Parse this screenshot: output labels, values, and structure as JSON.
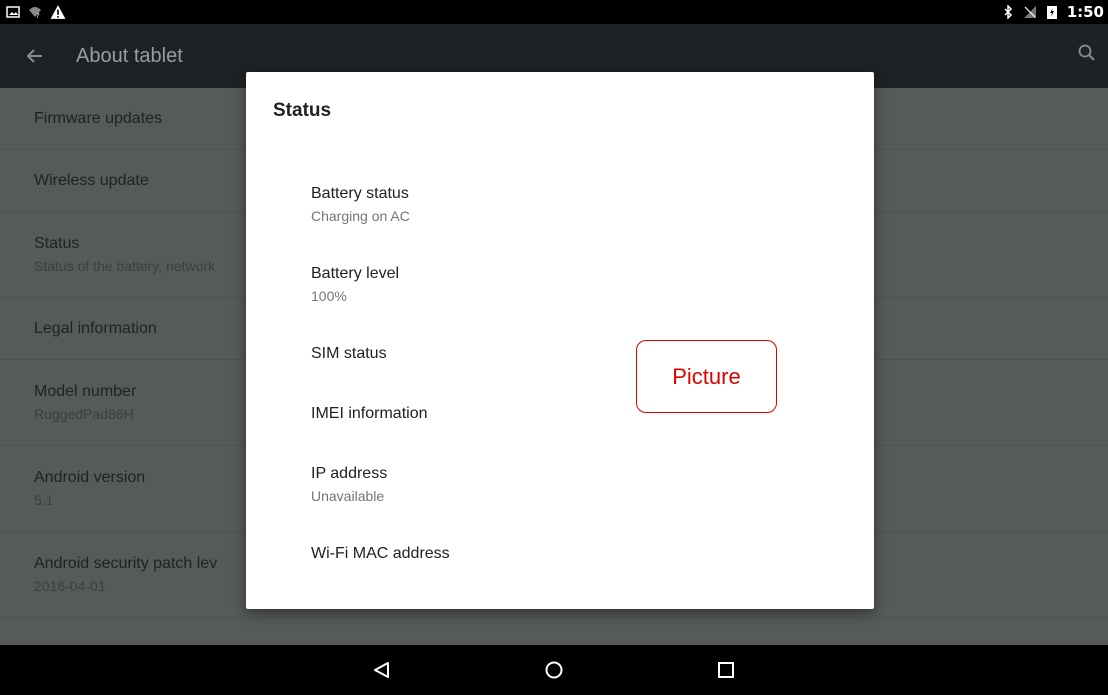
{
  "status_bar": {
    "time": "1:50",
    "left_icons": [
      "picture-notification-icon",
      "wifi-no-internet-icon",
      "warning-icon"
    ],
    "right_icons": [
      "bluetooth-icon",
      "no-signal-icon",
      "battery-charging-icon"
    ]
  },
  "app_bar": {
    "title": "About tablet",
    "back_icon": "arrow-left-icon",
    "search_icon": "search-icon"
  },
  "settings": {
    "items": [
      {
        "title": "Firmware updates",
        "subtitle": ""
      },
      {
        "title": "Wireless update",
        "subtitle": ""
      },
      {
        "title": "Status",
        "subtitle": "Status of the battery, network"
      },
      {
        "title": "Legal information",
        "subtitle": ""
      },
      {
        "title": "Model number",
        "subtitle": "RuggedPad86H"
      },
      {
        "title": "Android version",
        "subtitle": "5.1"
      },
      {
        "title": "Android security patch lev",
        "subtitle": "2016-04-01"
      }
    ]
  },
  "dialog": {
    "title": "Status",
    "items": [
      {
        "title": "Battery status",
        "subtitle": "Charging on AC"
      },
      {
        "title": "Battery level",
        "subtitle": "100%"
      },
      {
        "title": "SIM status",
        "subtitle": ""
      },
      {
        "title": "IMEI information",
        "subtitle": ""
      },
      {
        "title": "IP address",
        "subtitle": "Unavailable"
      },
      {
        "title": "Wi-Fi MAC address",
        "subtitle": ""
      }
    ],
    "annotation": "Picture"
  },
  "nav_bar": {
    "buttons": [
      "back-triangle-icon",
      "home-circle-icon",
      "recents-square-icon"
    ]
  },
  "colors": {
    "annotation": "#e00000",
    "app_bar": "#1f2224",
    "dim_background": "#575a5b"
  }
}
